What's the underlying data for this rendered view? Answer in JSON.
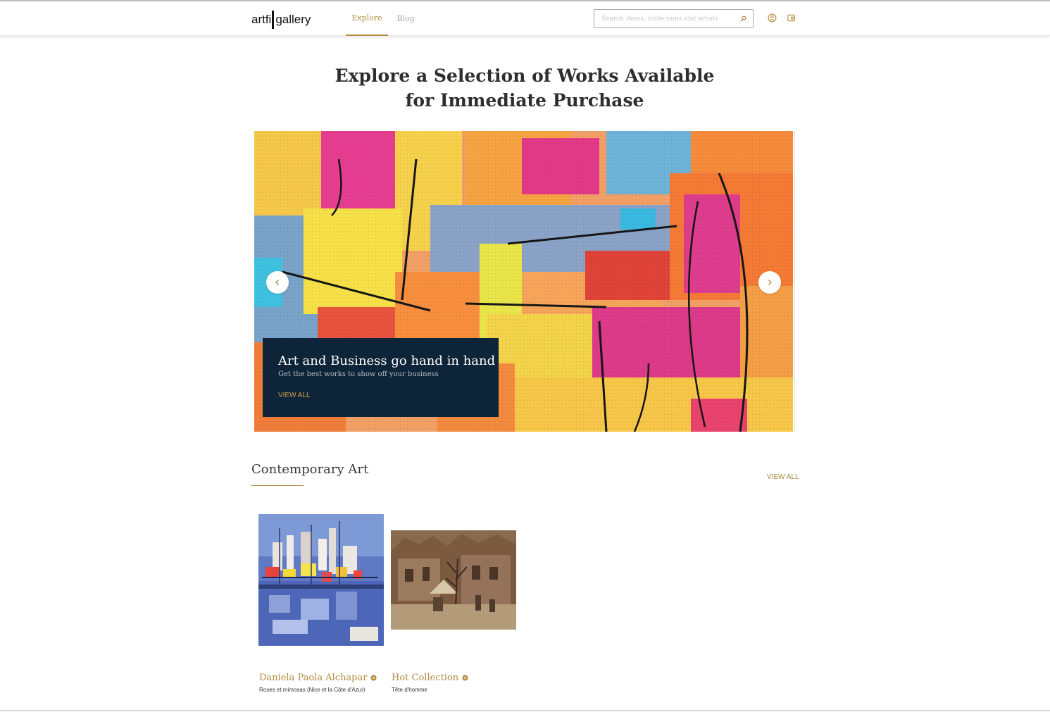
{
  "header": {
    "logo_left": "artfi",
    "logo_right": "gallery",
    "nav": [
      {
        "label": "Explore",
        "active": true
      },
      {
        "label": "Blog",
        "active": false
      }
    ],
    "search_placeholder": "Search items, collections and artists",
    "icons": [
      "search-icon",
      "user-icon",
      "wallet-icon"
    ]
  },
  "hero": {
    "title_line1": "Explore a Selection of Works Available",
    "title_line2": "for Immediate Purchase"
  },
  "carousel": {
    "caption_title": "Art and Business go hand in hand",
    "caption_subtitle": "Get the best works to show off your business",
    "caption_link": "VIEW ALL",
    "icons": [
      "chevron-left-icon",
      "chevron-right-icon"
    ]
  },
  "section": {
    "title": "Contemporary Art",
    "view_all": "VIEW ALL",
    "cards": [
      {
        "artist": "Daniela Paola Alchapar",
        "work": "Roses et mimosas (Nice et la Côte d'Azur)",
        "icon": "verified-badge-icon"
      },
      {
        "artist": "Hot Collection",
        "work": "Tête d'homme",
        "icon": "verified-badge-icon"
      }
    ]
  },
  "colors": {
    "accent": "#b38a3e",
    "caption_bg": "#0e2438",
    "text": "#2e2e2e"
  }
}
